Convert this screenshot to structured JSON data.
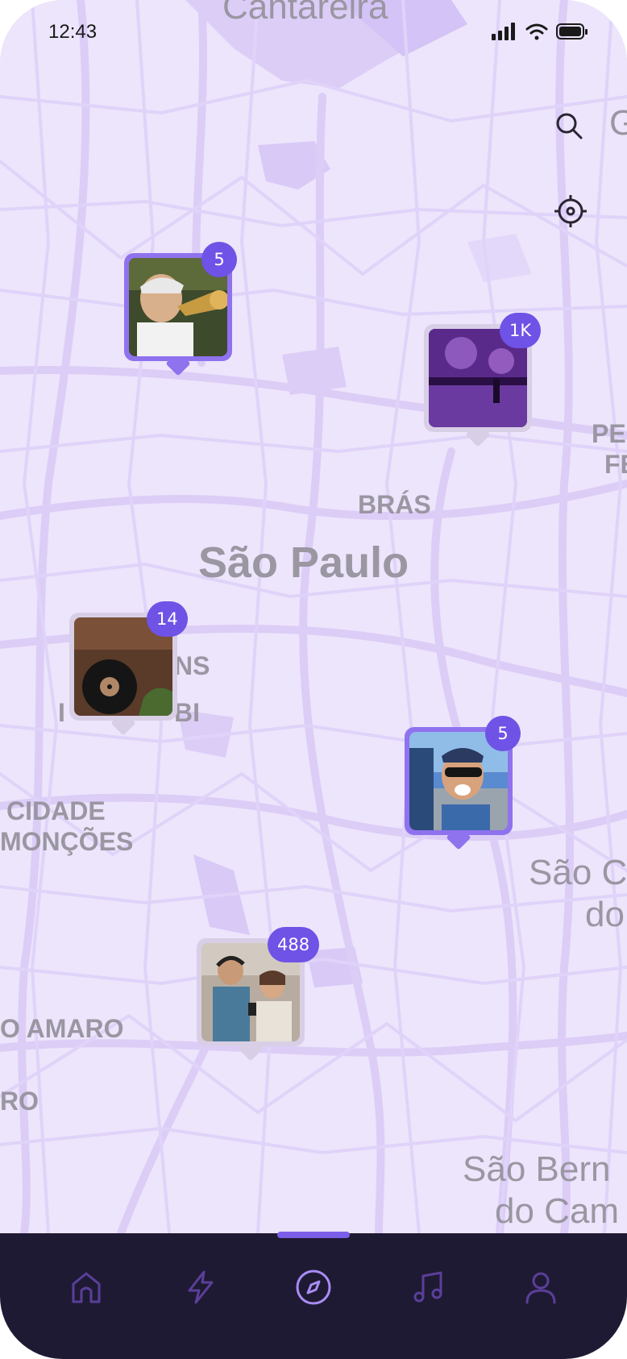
{
  "status": {
    "time": "12:43"
  },
  "map": {
    "places": {
      "cantareira": "Cantareira",
      "sao_paulo": "São Paulo",
      "bras": "BRÁS",
      "cidade_moncoes_1": "CIDADE",
      "cidade_moncoes_2": "MONÇÕES",
      "ns": "NS",
      "bi": "BI",
      "i_frag": "I",
      "santo_amaro": "O AMARO",
      "ro": "RO",
      "pe": "PE",
      "fe": "FE",
      "sao_c_1": "São C",
      "sao_c_2": "do",
      "sao_bern_1": "São Bern",
      "sao_bern_2": "do Cam",
      "edge_g": "G"
    },
    "search_icon": "search-icon",
    "locate_icon": "crosshair-icon"
  },
  "markers": [
    {
      "id": "trumpet",
      "count": "5",
      "active": true,
      "photo": "trumpet-player"
    },
    {
      "id": "concert",
      "count": "1K",
      "active": false,
      "photo": "concert-crowd"
    },
    {
      "id": "vinyl",
      "count": "14",
      "active": false,
      "photo": "vinyl-record"
    },
    {
      "id": "selfie",
      "count": "5",
      "active": true,
      "photo": "selfie-man"
    },
    {
      "id": "couple",
      "count": "488",
      "active": false,
      "photo": "couple-with-phone"
    }
  ],
  "tabbar": {
    "tabs": [
      {
        "name": "home",
        "icon": "home-icon"
      },
      {
        "name": "activity",
        "icon": "lightning-icon"
      },
      {
        "name": "explore",
        "icon": "compass-icon",
        "active": true
      },
      {
        "name": "music",
        "icon": "music-note-icon"
      },
      {
        "name": "profile",
        "icon": "user-icon"
      }
    ]
  },
  "colors": {
    "map_bg": "#ede5fb",
    "roads": "#dccdf7",
    "accent": "#6f52e6",
    "tabbar_bg": "#1f1a33",
    "tab_icon": "#5a3f9a",
    "tab_active": "#a88cf5"
  }
}
